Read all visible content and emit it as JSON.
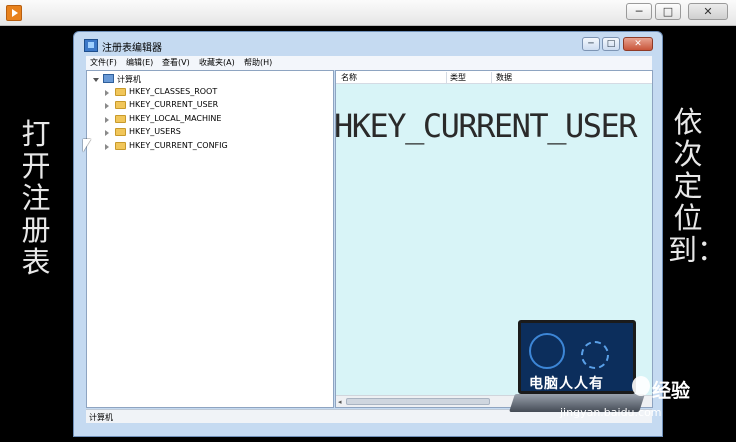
{
  "player": {
    "title": "",
    "controls": {
      "minimize": "─",
      "maximize": "□",
      "close": "✕"
    }
  },
  "video": {
    "left_caption": "打开注册表",
    "right_caption": "依次定位到：",
    "overlay_caption": "HKEY_CURRENT_USER"
  },
  "regedit": {
    "title": "注册表编辑器",
    "controls": {
      "minimize": "─",
      "maximize": "□",
      "close": "✕"
    },
    "menu": [
      "文件(F)",
      "编辑(E)",
      "查看(V)",
      "收藏夹(A)",
      "帮助(H)"
    ],
    "tree": {
      "root": "计算机",
      "keys": [
        "HKEY_CLASSES_ROOT",
        "HKEY_CURRENT_USER",
        "HKEY_LOCAL_MACHINE",
        "HKEY_USERS",
        "HKEY_CURRENT_CONFIG"
      ]
    },
    "columns": {
      "name": "名称",
      "type": "类型",
      "data": "数据"
    },
    "status": "计算机"
  },
  "watermark": {
    "logo_text": "电脑人人有",
    "brand": "经验",
    "url": "jingyan.baidu.com"
  },
  "colors": {
    "list_background": "#d8f4f7",
    "window_frame": "#c5daf1",
    "folder": "#f1c65a"
  },
  "icons": [
    "player-app-icon",
    "regedit-icon",
    "computer-icon",
    "folder-icon",
    "expand-arrow-icon",
    "mouse-cursor-icon"
  ]
}
